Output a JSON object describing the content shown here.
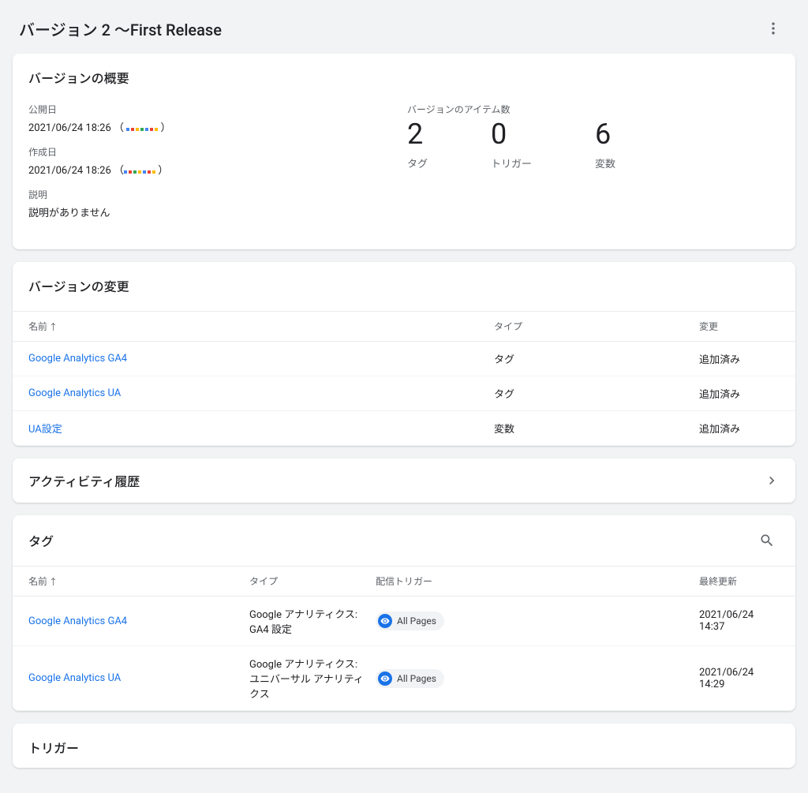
{
  "header": {
    "title": "バージョン 2 〜First Release"
  },
  "overview": {
    "title": "バージョンの概要",
    "pub_label": "公開日",
    "pub_value": "2021/06/24 18:26",
    "created_label": "作成日",
    "created_value": "2021/06/24 18:26",
    "desc_label": "説明",
    "desc_value": "説明がありません",
    "items_label": "バージョンのアイテム数",
    "counts": [
      {
        "num": "2",
        "label": "タグ"
      },
      {
        "num": "0",
        "label": "トリガー"
      },
      {
        "num": "6",
        "label": "変数"
      }
    ]
  },
  "changes": {
    "title": "バージョンの変更",
    "col_name": "名前",
    "col_type": "タイプ",
    "col_change": "変更",
    "rows": [
      {
        "name": "Google Analytics GA4",
        "type": "タグ",
        "change": "追加済み"
      },
      {
        "name": "Google Analytics UA",
        "type": "タグ",
        "change": "追加済み"
      },
      {
        "name": "UA設定",
        "type": "変数",
        "change": "追加済み"
      }
    ]
  },
  "activity": {
    "title": "アクティビティ履歴"
  },
  "tags": {
    "title": "タグ",
    "col_name": "名前",
    "col_type": "タイプ",
    "col_trigger": "配信トリガー",
    "col_updated": "最終更新",
    "trigger_chip": "All Pages",
    "rows": [
      {
        "name": "Google Analytics GA4",
        "type": "Google アナリティクス: GA4 設定",
        "updated": "2021/06/24 14:37"
      },
      {
        "name": "Google Analytics UA",
        "type": "Google アナリティクス: ユニバーサル アナリティクス",
        "updated": "2021/06/24 14:29"
      }
    ]
  },
  "triggers": {
    "title": "トリガー"
  }
}
